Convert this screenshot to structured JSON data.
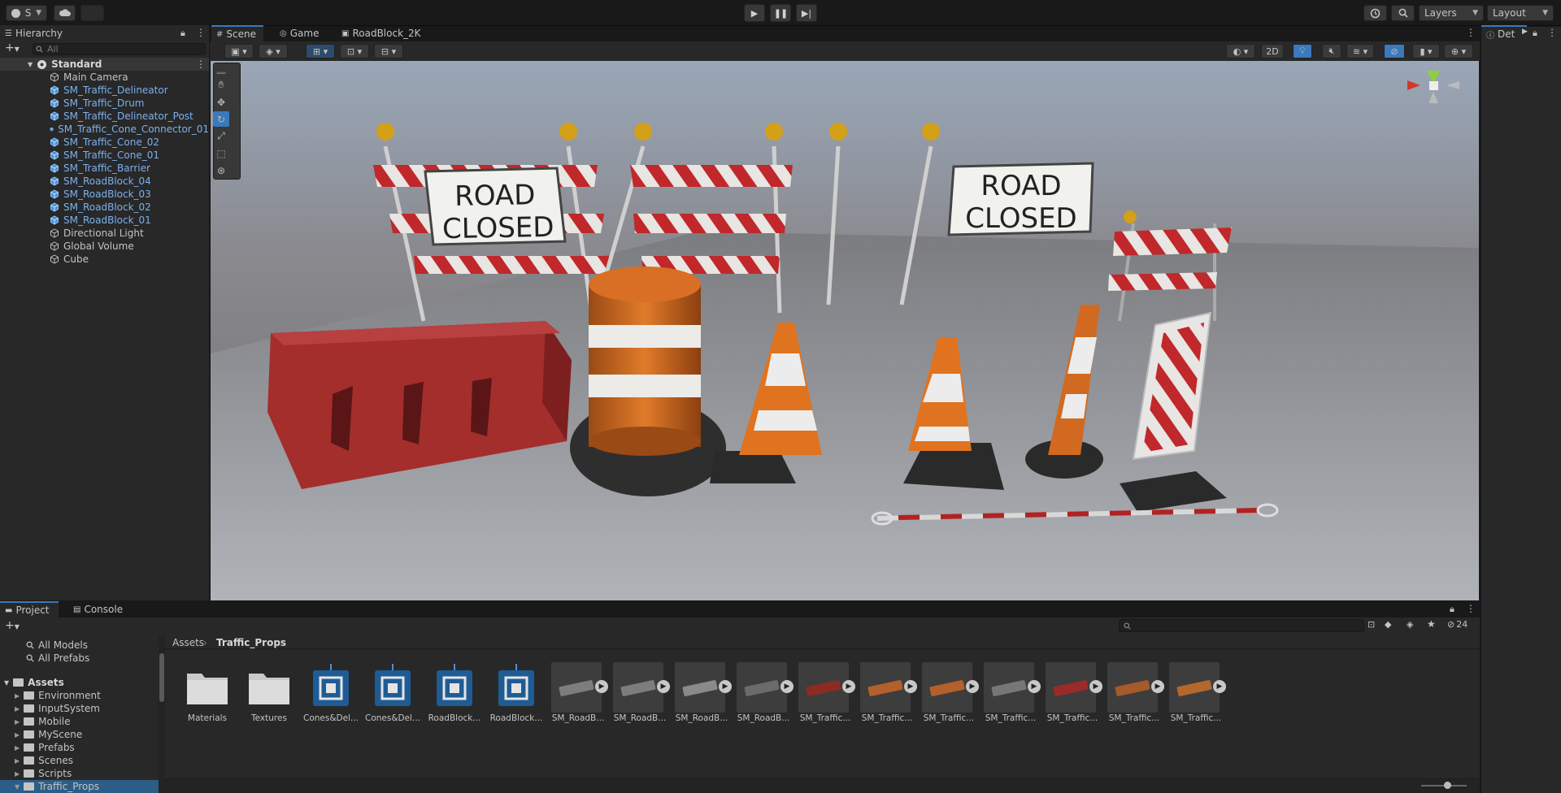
{
  "toolbar": {
    "account_label": "S",
    "layers_label": "Layers",
    "layout_label": "Layout"
  },
  "tabs": {
    "hierarchy": "Hierarchy",
    "scene": "Scene",
    "game": "Game",
    "roadblock": "RoadBlock_2K",
    "inspector": "Det",
    "project": "Project",
    "console": "Console"
  },
  "hierarchy": {
    "search_placeholder": "All",
    "scene_name": "Standard",
    "items": [
      {
        "label": "Main Camera",
        "prefab": false
      },
      {
        "label": "SM_Traffic_Delineator",
        "prefab": true
      },
      {
        "label": "SM_Traffic_Drum",
        "prefab": true
      },
      {
        "label": "SM_Traffic_Delineator_Post",
        "prefab": true
      },
      {
        "label": "SM_Traffic_Cone_Connector_01",
        "prefab": true
      },
      {
        "label": "SM_Traffic_Cone_02",
        "prefab": true
      },
      {
        "label": "SM_Traffic_Cone_01",
        "prefab": true
      },
      {
        "label": "SM_Traffic_Barrier",
        "prefab": true
      },
      {
        "label": "SM_RoadBlock_04",
        "prefab": true
      },
      {
        "label": "SM_RoadBlock_03",
        "prefab": true
      },
      {
        "label": "SM_RoadBlock_02",
        "prefab": true
      },
      {
        "label": "SM_RoadBlock_01",
        "prefab": true
      },
      {
        "label": "Directional Light",
        "prefab": false
      },
      {
        "label": "Global Volume",
        "prefab": false
      },
      {
        "label": "Cube",
        "prefab": false
      }
    ]
  },
  "scene": {
    "mode_2d": "2D",
    "sign_line1": "ROAD",
    "sign_line2": "CLOSED"
  },
  "project": {
    "favorites": [
      "All Models",
      "All Prefabs"
    ],
    "assets_root": "Assets",
    "folders": [
      "Environment",
      "InputSystem",
      "Mobile",
      "MyScene",
      "Prefabs",
      "Scenes",
      "Scripts",
      "Traffic_Props"
    ],
    "breadcrumb_root": "Assets",
    "breadcrumb_current": "Traffic_Props",
    "hidden_count": "24",
    "assets": [
      {
        "label": "Materials",
        "kind": "folder"
      },
      {
        "label": "Textures",
        "kind": "folder"
      },
      {
        "label": "Cones&Del...",
        "kind": "scene"
      },
      {
        "label": "Cones&Del...",
        "kind": "scene"
      },
      {
        "label": "RoadBlock...",
        "kind": "scene"
      },
      {
        "label": "RoadBlock...",
        "kind": "scene"
      },
      {
        "label": "SM_RoadB...",
        "kind": "mesh"
      },
      {
        "label": "SM_RoadB...",
        "kind": "mesh"
      },
      {
        "label": "SM_RoadB...",
        "kind": "mesh"
      },
      {
        "label": "SM_RoadB...",
        "kind": "mesh"
      },
      {
        "label": "SM_Traffic...",
        "kind": "mesh"
      },
      {
        "label": "SM_Traffic...",
        "kind": "mesh"
      },
      {
        "label": "SM_Traffic...",
        "kind": "mesh"
      },
      {
        "label": "SM_Traffic...",
        "kind": "mesh"
      },
      {
        "label": "SM_Traffic...",
        "kind": "mesh"
      },
      {
        "label": "SM_Traffic...",
        "kind": "mesh"
      },
      {
        "label": "SM_Traffic...",
        "kind": "mesh"
      }
    ]
  },
  "colors": {
    "accent": "#3a79bb",
    "prefab_text": "#7cb0ee",
    "panel": "#282828",
    "toolbar": "#191919"
  }
}
